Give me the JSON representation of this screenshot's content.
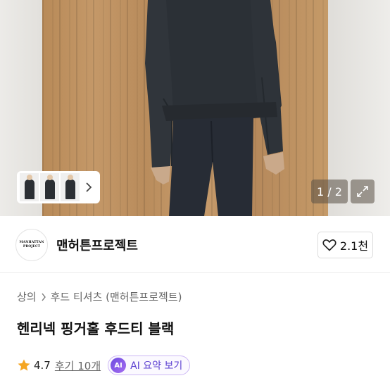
{
  "hero": {
    "pager": "1 / 2",
    "thumbnails": [
      "thumb-1",
      "thumb-2",
      "thumb-3"
    ],
    "icons": {
      "chevron": "chevron-right-icon",
      "expand": "expand-icon"
    }
  },
  "shop": {
    "logo_line1": "MANHATTAN",
    "logo_line2": "PROJECT",
    "name": "맨허튼프로젝트",
    "like_count": "2.1천"
  },
  "product": {
    "breadcrumb": [
      "상의",
      "후드 티셔츠 (맨허튼프로젝트)"
    ],
    "title": "헨리넥 핑거홀 후드티 블랙",
    "rating": "4.7",
    "reviews": "후기 10개",
    "ai_badge": "AI",
    "ai_label": "AI 요약 보기"
  },
  "colors": {
    "star": "#f5a623",
    "ai_accent": "#5b3fd1",
    "heart": "#222222"
  }
}
